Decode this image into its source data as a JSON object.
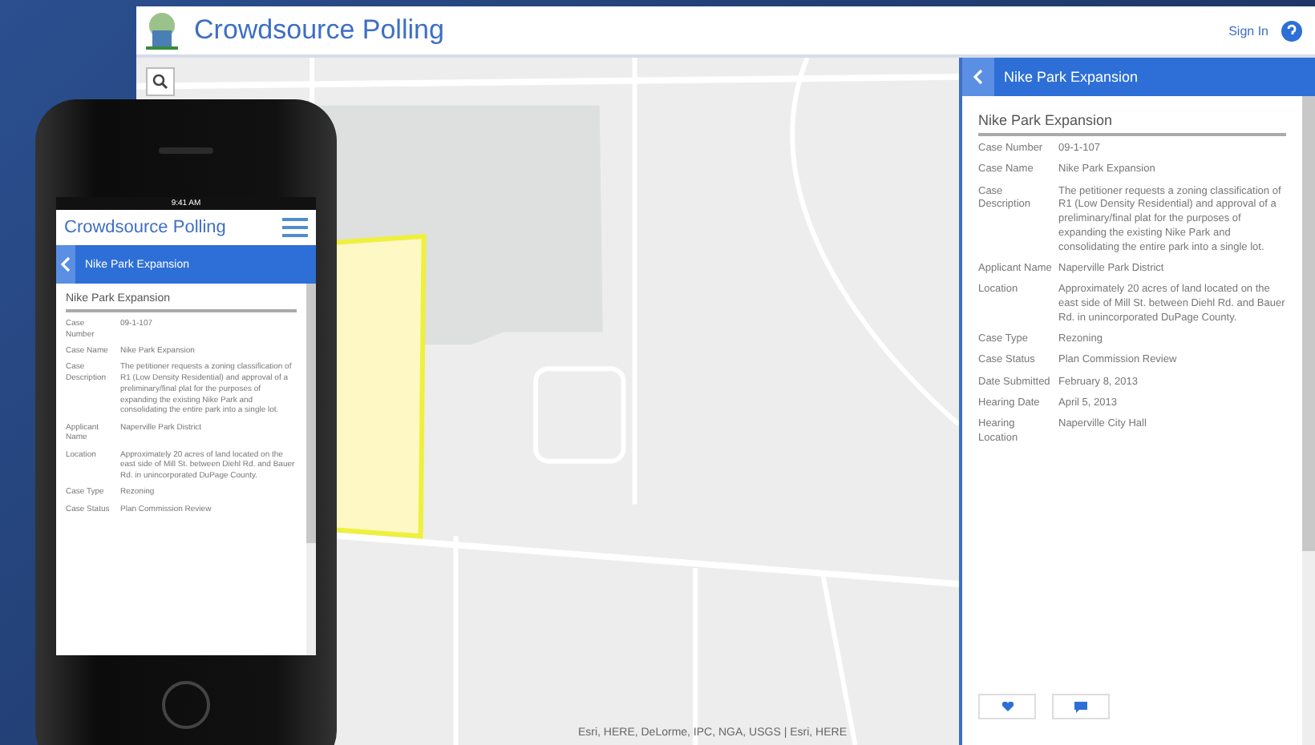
{
  "app": {
    "title": "Crowdsource Polling",
    "sign_in": "Sign In"
  },
  "map": {
    "attribution": "Esri, HERE, DeLorme, IPC, NGA, USGS | Esri, HERE"
  },
  "panel": {
    "header": "Nike Park Expansion",
    "title": "Nike Park Expansion",
    "fields": [
      {
        "label": "Case Number",
        "value": "09-1-107"
      },
      {
        "label": "Case Name",
        "value": "Nike Park Expansion"
      },
      {
        "label": "Case Description",
        "value": "The petitioner requests a zoning classification of R1 (Low Density Residential) and approval of a preliminary/final plat for the purposes of expanding the existing Nike Park and consolidating the entire park into a single lot."
      },
      {
        "label": "Applicant Name",
        "value": "Naperville Park District"
      },
      {
        "label": "Location",
        "value": "Approximately 20 acres of land located on the east side of Mill St. between Diehl Rd. and Bauer Rd. in unincorporated DuPage County."
      },
      {
        "label": "Case Type",
        "value": "Rezoning"
      },
      {
        "label": "Case Status",
        "value": "Plan Commission Review"
      },
      {
        "label": "Date Submitted",
        "value": "February 8, 2013"
      },
      {
        "label": "Hearing Date",
        "value": "April 5, 2013"
      },
      {
        "label": "Hearing Location",
        "value": "Naperville City Hall"
      }
    ]
  },
  "phone": {
    "time": "9:41 AM",
    "title": "Crowdsource Polling",
    "header": "Nike Park Expansion",
    "heading": "Nike Park Expansion",
    "fields": [
      {
        "label": "Case Number",
        "value": "09-1-107"
      },
      {
        "label": "Case Name",
        "value": "Nike Park Expansion"
      },
      {
        "label": "Case Description",
        "value": "The petitioner requests a zoning classification of R1 (Low Density Residential) and approval of a preliminary/final plat for the purposes of expanding the existing Nike Park and consolidating the entire park into a single lot."
      },
      {
        "label": "Applicant Name",
        "value": "Naperville Park District"
      },
      {
        "label": "Location",
        "value": "Approximately 20 acres of land located on the east side of Mill St. between Diehl Rd. and Bauer Rd. in unincorporated DuPage County."
      },
      {
        "label": "Case Type",
        "value": "Rezoning"
      },
      {
        "label": "Case Status",
        "value": "Plan Commission Review"
      }
    ]
  }
}
